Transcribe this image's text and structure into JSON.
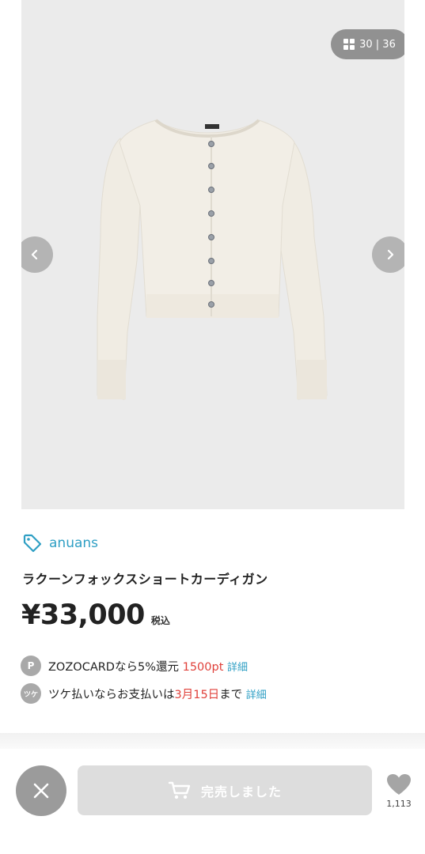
{
  "gallery": {
    "counter": "30 | 36",
    "icons": {
      "grid": "grid-icon",
      "prev": "chevron-left-icon",
      "next": "chevron-right-icon"
    }
  },
  "product": {
    "brand": "anuans",
    "brand_icon": "tag-icon",
    "title": "ラクーンフォックスショートカーディガン",
    "price": "¥33,000",
    "tax_label": "税込"
  },
  "benefits": {
    "card": {
      "badge": "P",
      "text_before": "ZOZOCARDなら5%還元",
      "points": "1500pt",
      "link": "詳細"
    },
    "tsuke": {
      "badge": "ツケ",
      "text_before": "ツケ払いならお支払いは",
      "date": "3月15日",
      "text_after": "まで",
      "link": "詳細"
    }
  },
  "footer": {
    "close_icon": "close-icon",
    "soldout_label": "完売しました",
    "cart_icon": "cart-icon",
    "heart_icon": "heart-icon",
    "favorite_count": "1,113"
  },
  "colors": {
    "accent": "#2f9fc4",
    "price_highlight": "#e0413b",
    "disabled_button": "#dddddd",
    "image_bg": "#ebebeb"
  }
}
